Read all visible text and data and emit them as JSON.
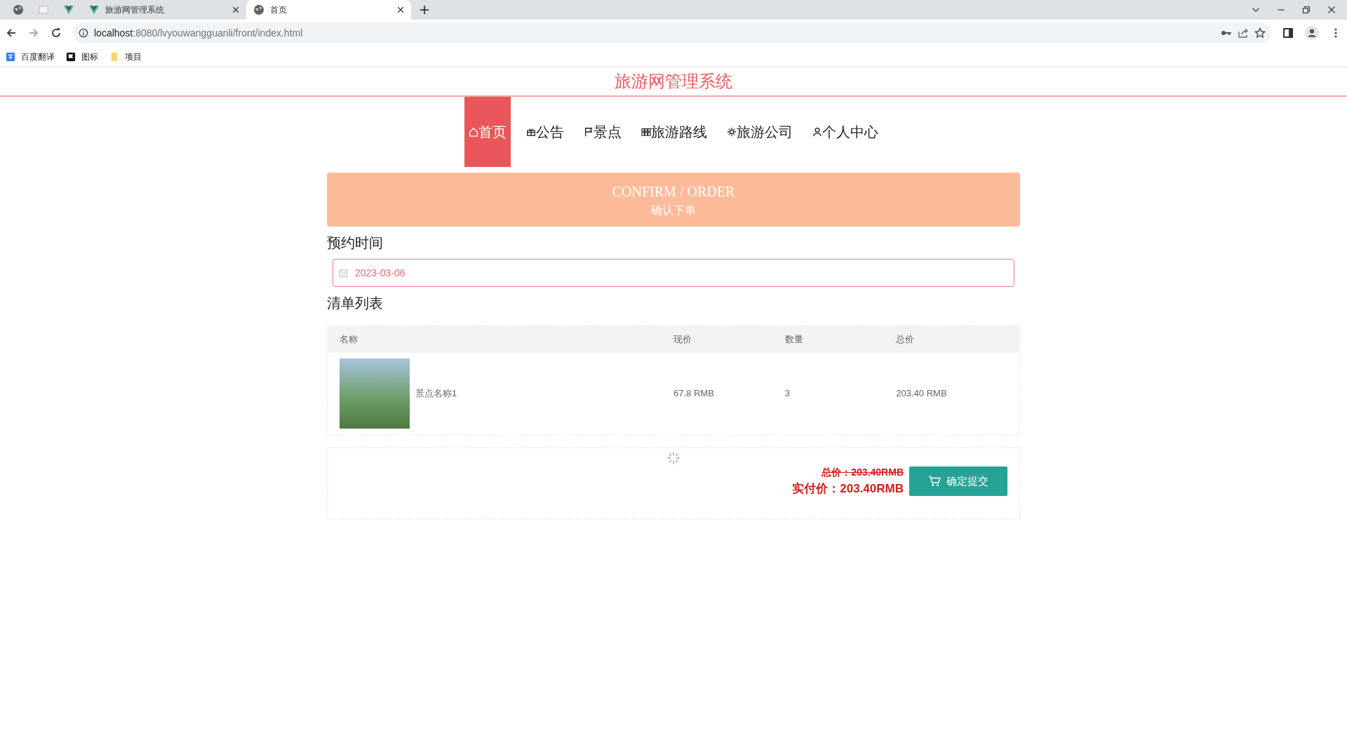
{
  "browser": {
    "tabs": [
      {
        "kind": "globe",
        "selected": false
      },
      {
        "kind": "page",
        "selected": false
      },
      {
        "kind": "vue",
        "selected": false
      },
      {
        "kind": "vue",
        "title": "旅游网管理系统",
        "selected": false
      },
      {
        "kind": "globe",
        "title": "首页",
        "selected": true
      }
    ],
    "url_host": "localhost",
    "url_rest": ":8080/lvyouwangguanli/front/index.html",
    "bookmarks": [
      {
        "kind": "translate",
        "label": "百度翻译"
      },
      {
        "kind": "flag",
        "label": "图标"
      },
      {
        "kind": "folder",
        "label": "项目"
      }
    ]
  },
  "site_title": "旅游网管理系统",
  "nav": [
    {
      "kind": "home",
      "label": "首页",
      "selected": true
    },
    {
      "kind": "gift",
      "label": "公告",
      "selected": false
    },
    {
      "kind": "flag",
      "label": "景点",
      "selected": false
    },
    {
      "kind": "grid",
      "label": "旅游路线",
      "selected": false
    },
    {
      "kind": "gear",
      "label": "旅游公司",
      "selected": false
    },
    {
      "kind": "user",
      "label": "个人中心",
      "selected": false
    }
  ],
  "banner": {
    "title_en": "CONFIRM / ORDER",
    "title_cn": "确认下单"
  },
  "booking": {
    "label": "预约时间",
    "date": "2023-03-06"
  },
  "list": {
    "label": "清单列表",
    "columns": [
      "名称",
      "现价",
      "数量",
      "总价"
    ],
    "rows": [
      {
        "name": "景点名称1",
        "price": "67.8 RMB",
        "quantity": "3",
        "total": "203.40 RMB"
      }
    ]
  },
  "summary": {
    "total": "总价：203.40RMB",
    "paid": "实付价：203.40RMB",
    "submit": "确定提交"
  }
}
